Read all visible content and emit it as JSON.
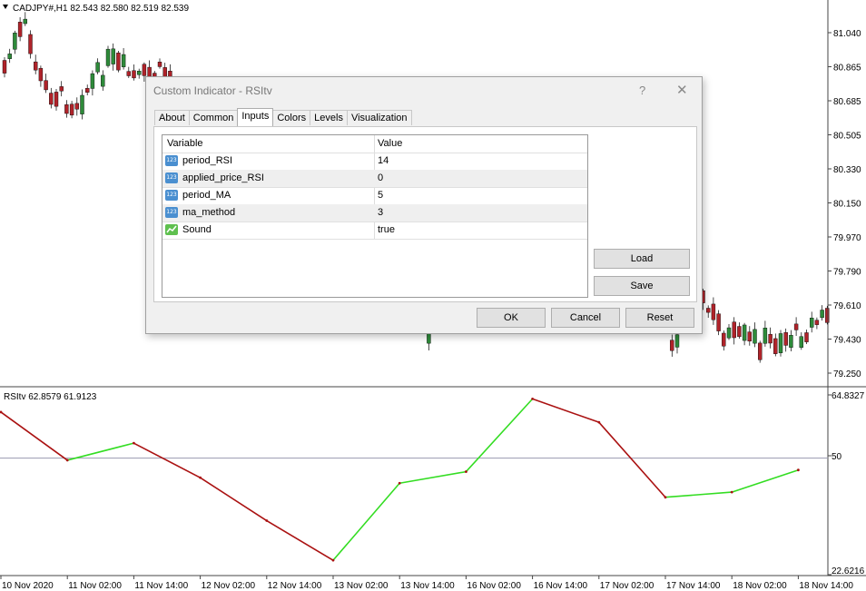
{
  "chart": {
    "title": "CADJPY#,H1  82.543 82.580 82.519 82.539",
    "price_ticks": [
      "81.040",
      "80.865",
      "80.685",
      "80.505",
      "80.330",
      "80.150",
      "79.970",
      "79.790",
      "79.610",
      "79.430",
      "79.250"
    ],
    "indicator_label": "RSItv 62.8579 61.9123",
    "indicator_ticks": [
      "64.8327",
      "50",
      "22.6216"
    ],
    "time_labels": [
      "10 Nov 2020",
      "11 Nov 02:00",
      "11 Nov 14:00",
      "12 Nov 02:00",
      "12 Nov 14:00",
      "13 Nov 02:00",
      "13 Nov 14:00",
      "16 Nov 02:00",
      "16 Nov 14:00",
      "17 Nov 02:00",
      "17 Nov 14:00",
      "18 Nov 02:00",
      "18 Nov 14:00"
    ],
    "colors": {
      "up": "#2e8b3a",
      "down": "#b0232a",
      "rsi_up": "#33dd22",
      "rsi_down": "#aa1111",
      "level": "#9a9ab0"
    }
  },
  "chart_data": {
    "type": "line",
    "title": "RSItv",
    "level_line": 50,
    "ylim": [
      22.6216,
      64.8327
    ],
    "x": [
      "10 Nov 2020",
      "11 Nov 02:00",
      "11 Nov 14:00",
      "12 Nov 02:00",
      "12 Nov 14:00",
      "13 Nov 02:00",
      "13 Nov 14:00",
      "16 Nov 02:00",
      "16 Nov 14:00",
      "17 Nov 02:00",
      "17 Nov 14:00",
      "18 Nov 02:00",
      "18 Nov 14:00"
    ],
    "series": [
      {
        "name": "RSItv",
        "values": [
          60.8,
          49.5,
          53.5,
          45.4,
          35.3,
          26.0,
          44.1,
          46.8,
          63.9,
          58.4,
          40.8,
          42.0,
          47.2
        ]
      }
    ]
  },
  "dialog": {
    "title": "Custom Indicator - RSItv",
    "help": "?",
    "close": "✕",
    "tabs": [
      "About",
      "Common",
      "Inputs",
      "Colors",
      "Levels",
      "Visualization"
    ],
    "active_tab": "Inputs",
    "columns": {
      "variable": "Variable",
      "value": "Value"
    },
    "rows": [
      {
        "icon": "123",
        "variable": "period_RSI",
        "value": "14"
      },
      {
        "icon": "123",
        "variable": "applied_price_RSI",
        "value": "0"
      },
      {
        "icon": "123",
        "variable": "period_MA",
        "value": "5"
      },
      {
        "icon": "123",
        "variable": "ma_method",
        "value": "3"
      },
      {
        "icon": "bool",
        "variable": "Sound",
        "value": "true"
      }
    ],
    "buttons": {
      "load": "Load",
      "save": "Save",
      "ok": "OK",
      "cancel": "Cancel",
      "reset": "Reset"
    }
  }
}
